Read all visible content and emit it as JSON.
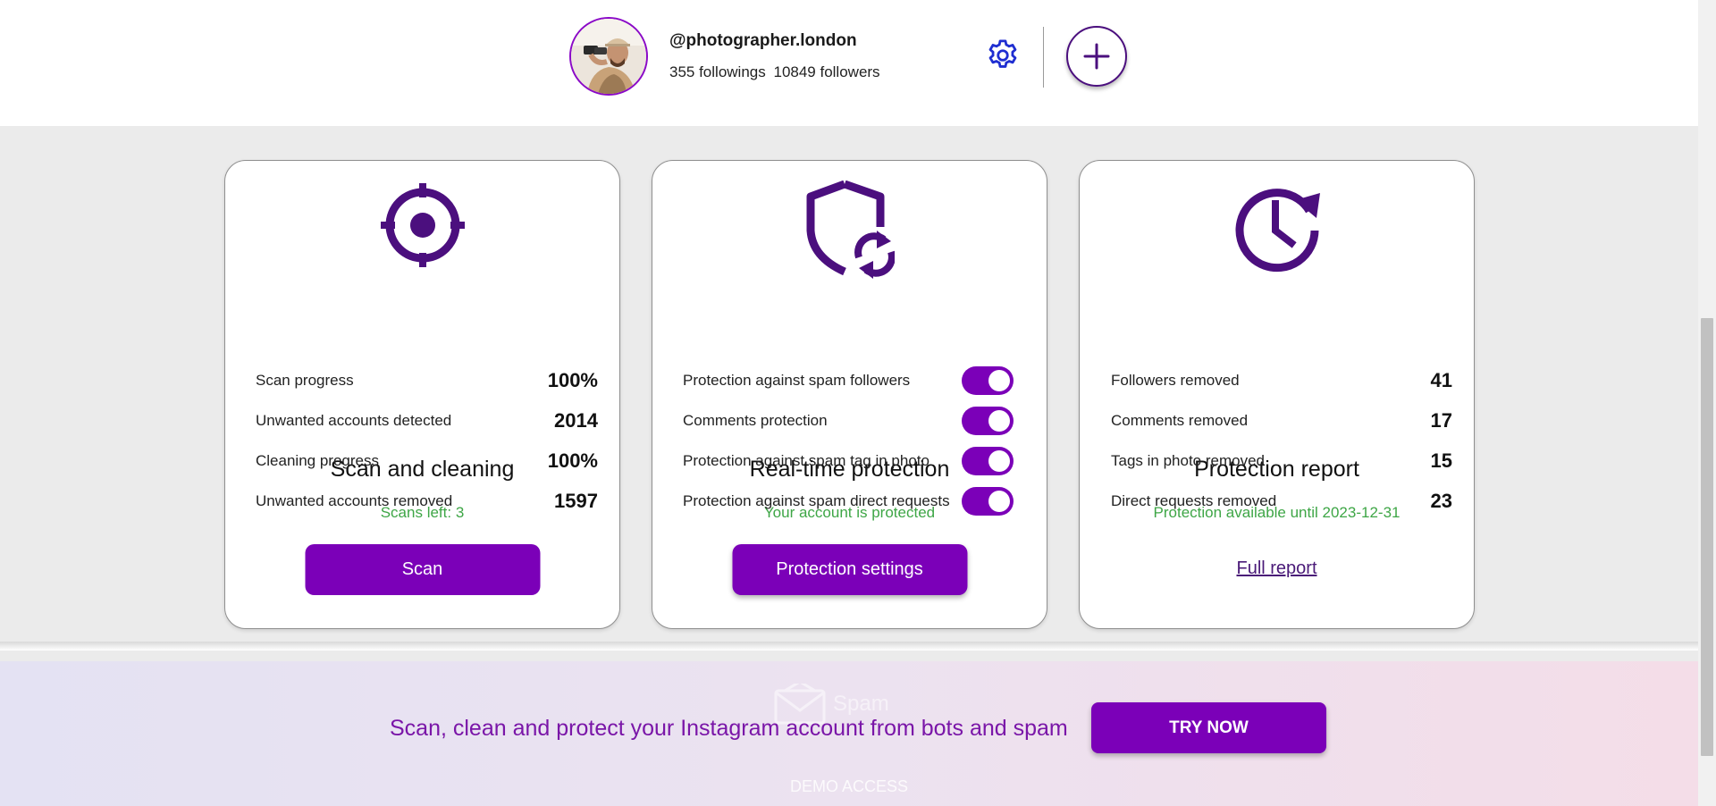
{
  "header": {
    "handle": "@photographer.london",
    "followings": "355 followings",
    "followers": "10849 followers"
  },
  "cards": {
    "scan": {
      "title": "Scan and cleaning",
      "subtitle": "Scans left: 3",
      "rows": [
        {
          "label": "Scan progress",
          "value": "100%"
        },
        {
          "label": "Unwanted accounts detected",
          "value": "2014"
        },
        {
          "label": "Cleaning progress",
          "value": "100%"
        },
        {
          "label": "Unwanted accounts removed",
          "value": "1597"
        }
      ],
      "button": "Scan"
    },
    "protection": {
      "title": "Real-time protection",
      "subtitle": "Your account is protected",
      "rows": [
        {
          "label": "Protection against spam followers",
          "on": true
        },
        {
          "label": "Comments protection",
          "on": true
        },
        {
          "label": "Protection against spam tag in photo",
          "on": true
        },
        {
          "label": "Protection against spam direct requests",
          "on": true
        }
      ],
      "button": "Protection settings"
    },
    "report": {
      "title": "Protection report",
      "subtitle": "Protection available until 2023-12-31",
      "rows": [
        {
          "label": "Followers removed",
          "value": "41"
        },
        {
          "label": "Comments removed",
          "value": "17"
        },
        {
          "label": "Tags in photo removed",
          "value": "15"
        },
        {
          "label": "Direct requests removed",
          "value": "23"
        }
      ],
      "link": "Full report"
    }
  },
  "banner": {
    "logo_text": "Spam",
    "text": "Scan, clean and protect your Instagram account from bots and spam",
    "button": "TRY NOW",
    "demo": "DEMO ACCESS"
  },
  "colors": {
    "accent": "#7b00b8",
    "icon": "#4b0f7e",
    "status_green": "#3ea646"
  },
  "icons": {
    "scan": "crosshair-icon",
    "protection": "shield-sync-icon",
    "report": "clock-refresh-icon",
    "settings": "gear-icon",
    "add": "plus-icon",
    "logo": "envelope-icon"
  }
}
